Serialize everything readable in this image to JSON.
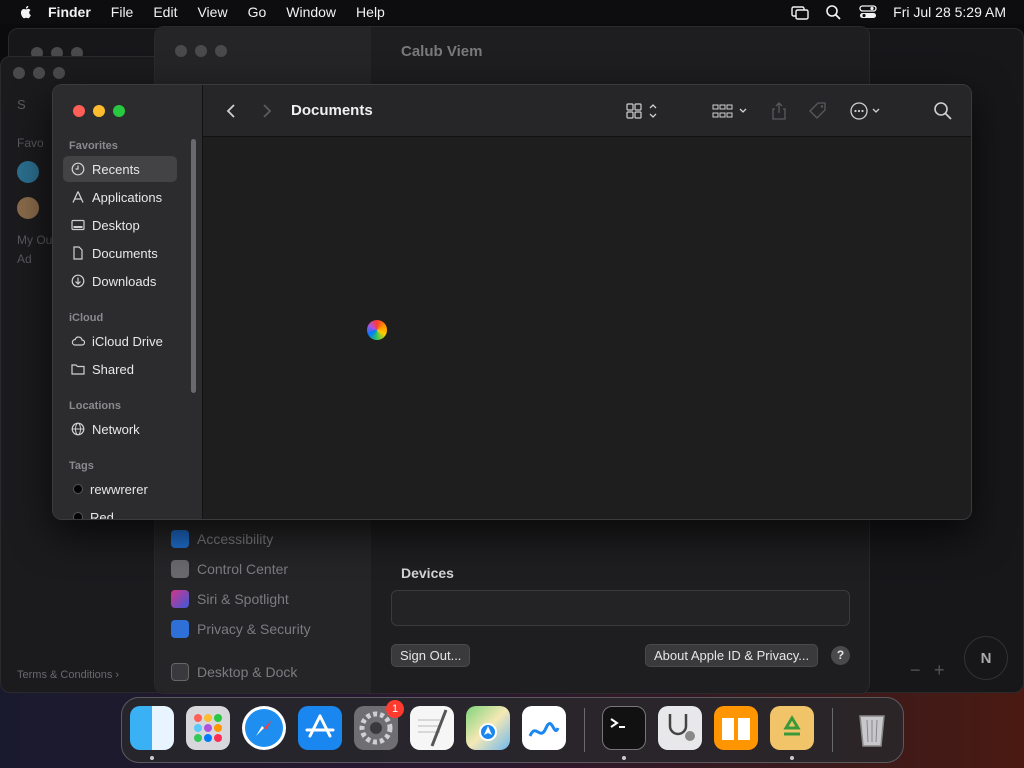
{
  "menubar": {
    "app_name": "Finder",
    "items": [
      "File",
      "Edit",
      "View",
      "Go",
      "Window",
      "Help"
    ],
    "clock": "Fri Jul 28  5:29 AM"
  },
  "settings_window": {
    "title": "Calub Viem",
    "sidebar_items": [
      "Accessibility",
      "Control Center",
      "Siri & Spotlight",
      "Privacy & Security",
      "Desktop & Dock"
    ],
    "devices_label": "Devices",
    "sign_out_label": "Sign Out...",
    "about_label": "About Apple ID & Privacy...",
    "help_label": "?"
  },
  "bg_left": {
    "favorites_label": "Favo",
    "my_label": "My Ou",
    "add_label": "Ad",
    "terms_label": "Terms & Conditions ›",
    "search_letter": "S"
  },
  "map": {
    "compass_label": "N"
  },
  "finder": {
    "title": "Documents",
    "sections": {
      "favorites": "Favorites",
      "icloud": "iCloud",
      "locations": "Locations",
      "tags": "Tags"
    },
    "favorites": [
      "Recents",
      "Applications",
      "Desktop",
      "Documents",
      "Downloads"
    ],
    "icloud_items": [
      "iCloud Drive",
      "Shared"
    ],
    "locations_items": [
      "Network"
    ],
    "tags_items": [
      "rewwrerer",
      "Red"
    ],
    "selected": "Recents"
  },
  "dock": {
    "apps": [
      "Finder",
      "Launchpad",
      "Safari",
      "App Store",
      "System Settings",
      "TextEdit",
      "Maps",
      "Freeform",
      "Terminal",
      "Disk Utility",
      "Books",
      "Archive Utility",
      "Trash"
    ],
    "settings_badge": "1"
  }
}
